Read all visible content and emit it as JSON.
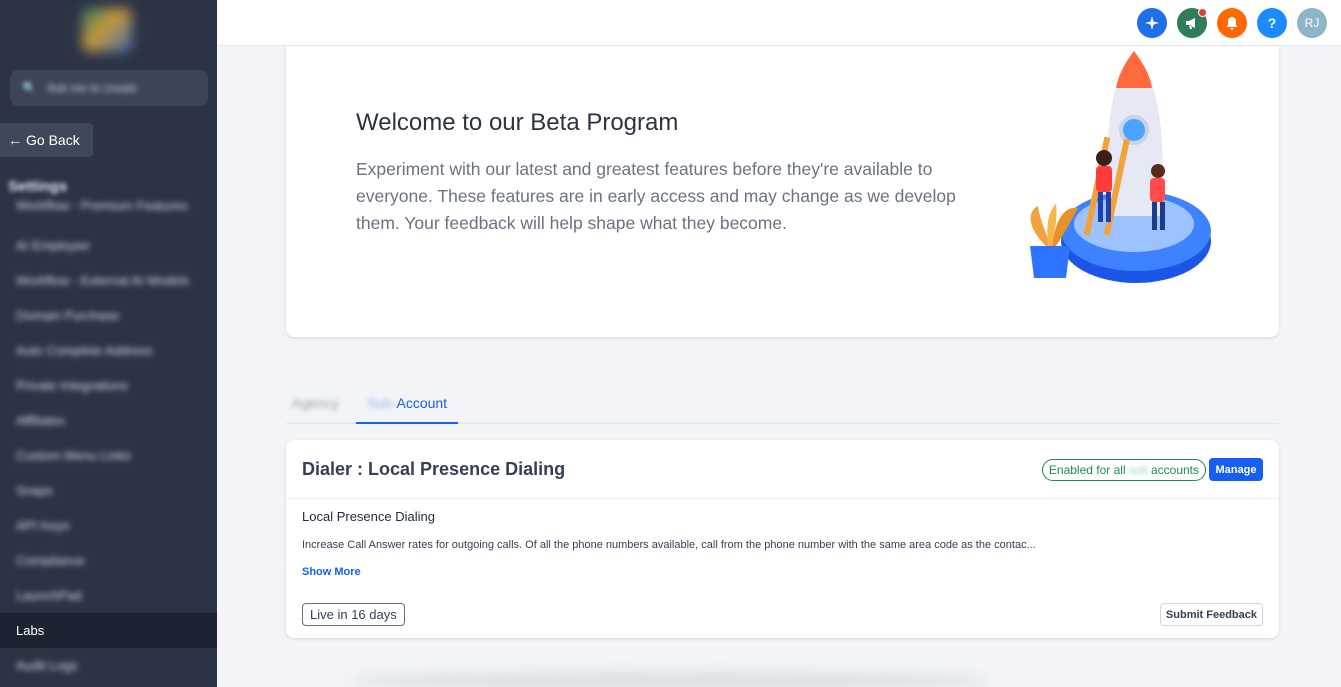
{
  "sidebar": {
    "search_placeholder": "Ask me to create",
    "search_shortcut": "⌘",
    "go_back_label": "Go Back",
    "settings_title": "Settings",
    "items": [
      {
        "label": "Workflow - Premium Features"
      },
      {
        "label": "AI Employee"
      },
      {
        "label": "Workflow - External AI Models"
      },
      {
        "label": "Domain Purchase"
      },
      {
        "label": "Auto Complete Address"
      },
      {
        "label": "Private Integrations"
      },
      {
        "label": "Affiliates"
      },
      {
        "label": "Custom Menu Links"
      },
      {
        "label": "Snaps"
      },
      {
        "label": "API Keys"
      },
      {
        "label": "Compliance"
      },
      {
        "label": "LaunchPad"
      },
      {
        "label": "Labs"
      },
      {
        "label": "Audit Logs"
      }
    ]
  },
  "topbar": {
    "icons": [
      {
        "name": "ai-assistant-icon",
        "color": "#1f6feb",
        "glyph": "✦"
      },
      {
        "name": "announcement-icon",
        "color": "#2f7d5b",
        "glyph": "📢"
      },
      {
        "name": "notification-bell-icon",
        "color": "#ff6a00",
        "glyph": "🔔"
      },
      {
        "name": "help-icon",
        "color": "#1a8cff",
        "glyph": "?"
      }
    ],
    "avatar_initials": "RJ"
  },
  "hero": {
    "title": "Welcome to our Beta Program",
    "description": "Experiment with our latest and greatest features before they're available to everyone. These features are in early access and may change as we develop them. Your feedback will help shape what they become."
  },
  "tabs": {
    "agency_label": "Agency",
    "sub_prefix": "Sub-",
    "sub_label": "Account"
  },
  "feature": {
    "title": "Dialer : Local Presence Dialing",
    "enabled_prefix": "Enabled for all",
    "enabled_hidden": "sub",
    "enabled_suffix": "accounts",
    "manage_label": "Manage",
    "name": "Local Presence Dialing",
    "description": "Increase Call Answer rates for outgoing calls. Of all the phone numbers available, call from the phone number with the same area code as the contac...",
    "show_more_label": "Show More",
    "live_prefix": "Live in",
    "live_days": "16",
    "live_suffix": "days",
    "feedback_label": "Submit Feedback"
  },
  "colors": {
    "primary": "#155eef",
    "sidebar_bg": "#2b3345",
    "success": "#1f8a55"
  }
}
